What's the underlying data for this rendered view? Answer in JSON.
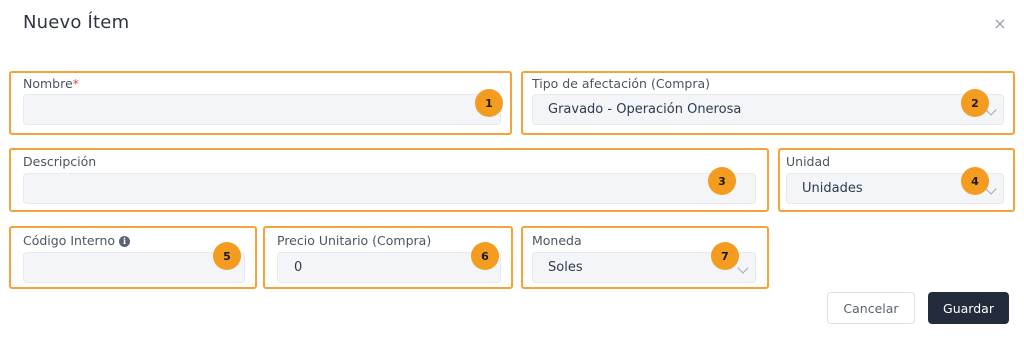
{
  "dialog": {
    "title": "Nuevo Ítem",
    "close_icon": "×"
  },
  "fields": {
    "nombre": {
      "label": "Nombre",
      "required_mark": "*",
      "value": "",
      "badge": "1"
    },
    "tipo_afectacion": {
      "label": "Tipo de afectación (Compra)",
      "value": "Gravado - Operación Onerosa",
      "badge": "2"
    },
    "descripcion": {
      "label": "Descripción",
      "value": "",
      "badge": "3"
    },
    "unidad": {
      "label": "Unidad",
      "value": "Unidades",
      "badge": "4"
    },
    "codigo_interno": {
      "label": "Código Interno",
      "info_icon": "i",
      "value": "",
      "badge": "5"
    },
    "precio_unitario": {
      "label": "Precio Unitario (Compra)",
      "value": "0",
      "badge": "6"
    },
    "moneda": {
      "label": "Moneda",
      "value": "Soles",
      "badge": "7"
    }
  },
  "buttons": {
    "cancel_label": "Cancelar",
    "save_label": "Guardar"
  },
  "colors": {
    "highlight_border": "#f2a33a",
    "badge": "#f39c1f",
    "primary_button": "#232b3d"
  }
}
